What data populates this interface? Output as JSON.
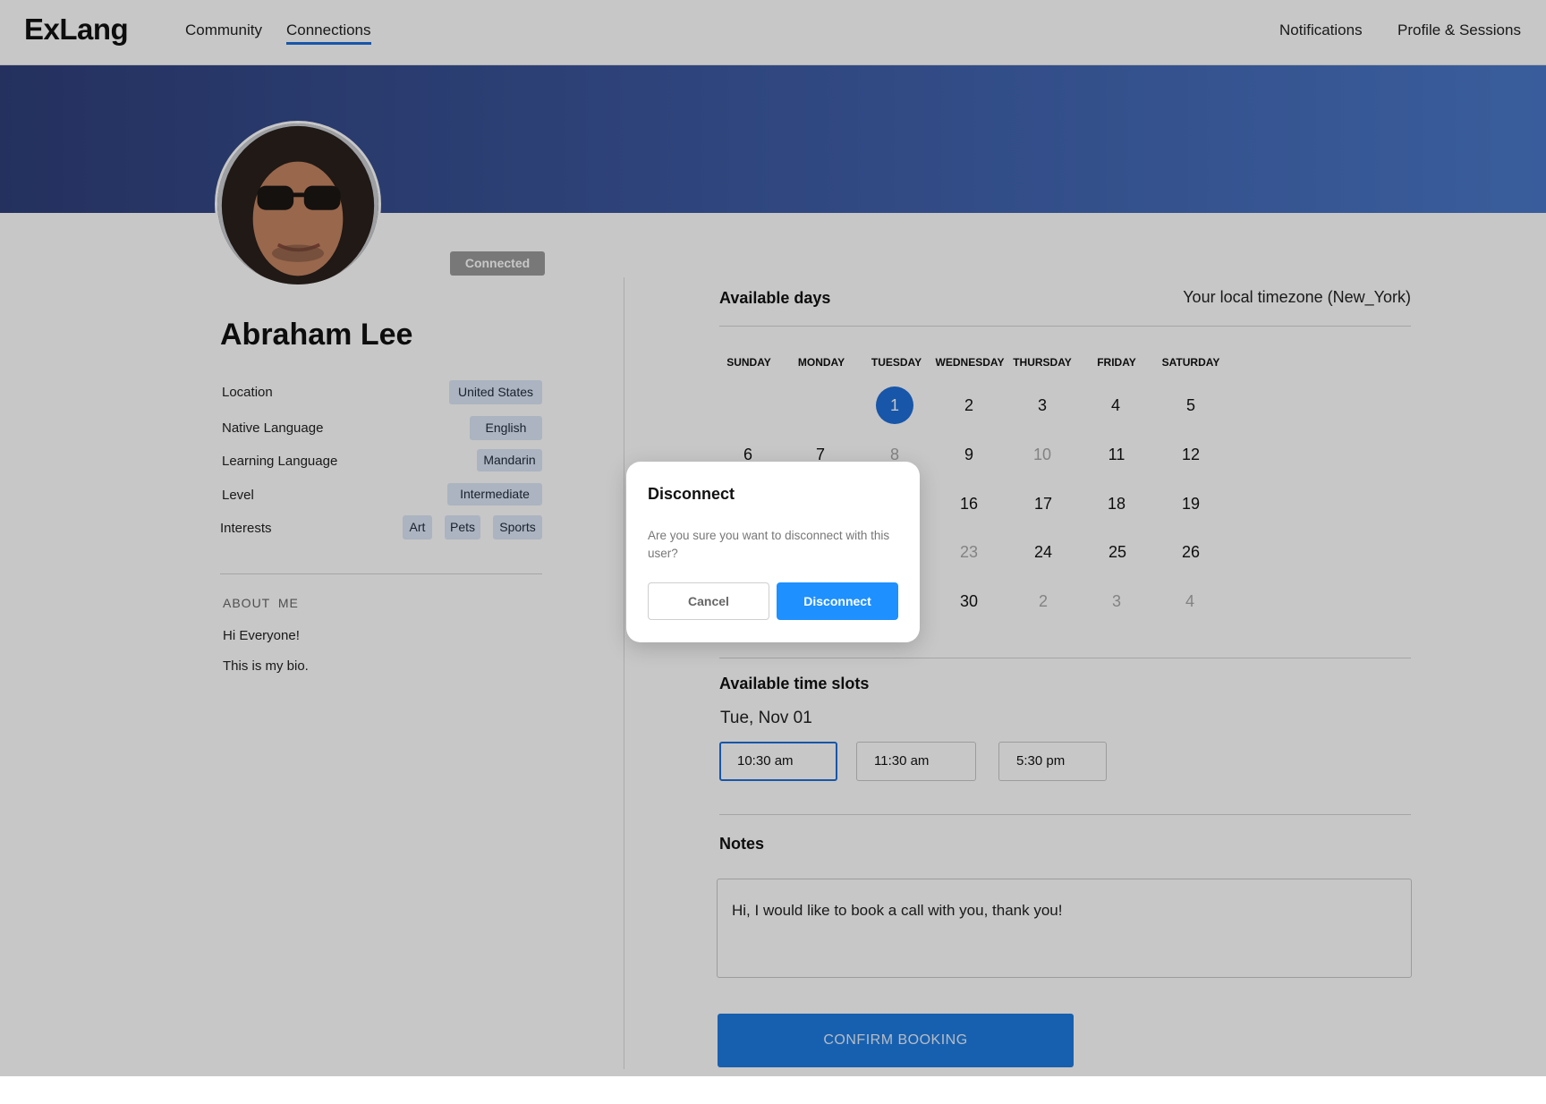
{
  "header": {
    "brand": "ExLang",
    "nav": [
      {
        "label": "Community",
        "active": false
      },
      {
        "label": "Connections",
        "active": true
      }
    ],
    "right_nav": [
      {
        "label": "Notifications"
      },
      {
        "label": "Profile & Sessions"
      }
    ]
  },
  "profile": {
    "status_badge": "Connected",
    "name": "Abraham Lee",
    "fields": {
      "location": {
        "label": "Location",
        "value": "United States"
      },
      "native_language": {
        "label": "Native Language",
        "value": "English"
      },
      "learning_language": {
        "label": "Learning Language",
        "value": "Mandarin"
      },
      "level": {
        "label": "Level",
        "value": "Intermediate"
      },
      "interests": {
        "label": "Interests",
        "values": [
          "Art",
          "Pets",
          "Sports"
        ]
      }
    },
    "about": {
      "title": "ABOUT ME",
      "lines": [
        "Hi Everyone!",
        "This is my bio."
      ]
    }
  },
  "calendar": {
    "title": "Available days",
    "timezone": "Your local timezone (New_York)",
    "weekdays": [
      "SUNDAY",
      "MONDAY",
      "TUESDAY",
      "WEDNESDAY",
      "THURSDAY",
      "FRIDAY",
      "SATURDAY"
    ],
    "weeks": [
      [
        null,
        null,
        {
          "d": "1",
          "state": "selected"
        },
        {
          "d": "2"
        },
        {
          "d": "3"
        },
        {
          "d": "4"
        },
        {
          "d": "5"
        }
      ],
      [
        {
          "d": "6"
        },
        {
          "d": "7"
        },
        {
          "d": "8",
          "state": "muted"
        },
        {
          "d": "9"
        },
        {
          "d": "10",
          "state": "muted"
        },
        {
          "d": "11"
        },
        {
          "d": "12"
        }
      ],
      [
        null,
        null,
        null,
        {
          "d": "16"
        },
        {
          "d": "17"
        },
        {
          "d": "18"
        },
        {
          "d": "19"
        }
      ],
      [
        null,
        null,
        null,
        {
          "d": "23",
          "state": "muted"
        },
        {
          "d": "24"
        },
        {
          "d": "25"
        },
        {
          "d": "26"
        }
      ],
      [
        null,
        null,
        null,
        {
          "d": "30"
        },
        {
          "d": "2",
          "state": "muted"
        },
        {
          "d": "3",
          "state": "muted"
        },
        {
          "d": "4",
          "state": "muted"
        }
      ]
    ]
  },
  "time_slots": {
    "title": "Available time slots",
    "date_label": "Tue, Nov 01",
    "slots": [
      {
        "label": "10:30 am",
        "selected": true
      },
      {
        "label": "11:30 am",
        "selected": false
      },
      {
        "label": "5:30 pm",
        "selected": false
      }
    ]
  },
  "notes": {
    "title": "Notes",
    "value": "Hi, I would like to book a call with you, thank you!"
  },
  "confirm_label": "CONFIRM BOOKING",
  "modal": {
    "title": "Disconnect",
    "message": "Are you sure you want to disconnect with this user?",
    "cancel_label": "Cancel",
    "confirm_label": "Disconnect"
  },
  "colors": {
    "accent": "#1e6fd9",
    "modal_button": "#1e90ff",
    "banner_start": "#2f3f7a",
    "banner_end": "#4a78c8",
    "chip_bg": "#dbe7f6"
  }
}
